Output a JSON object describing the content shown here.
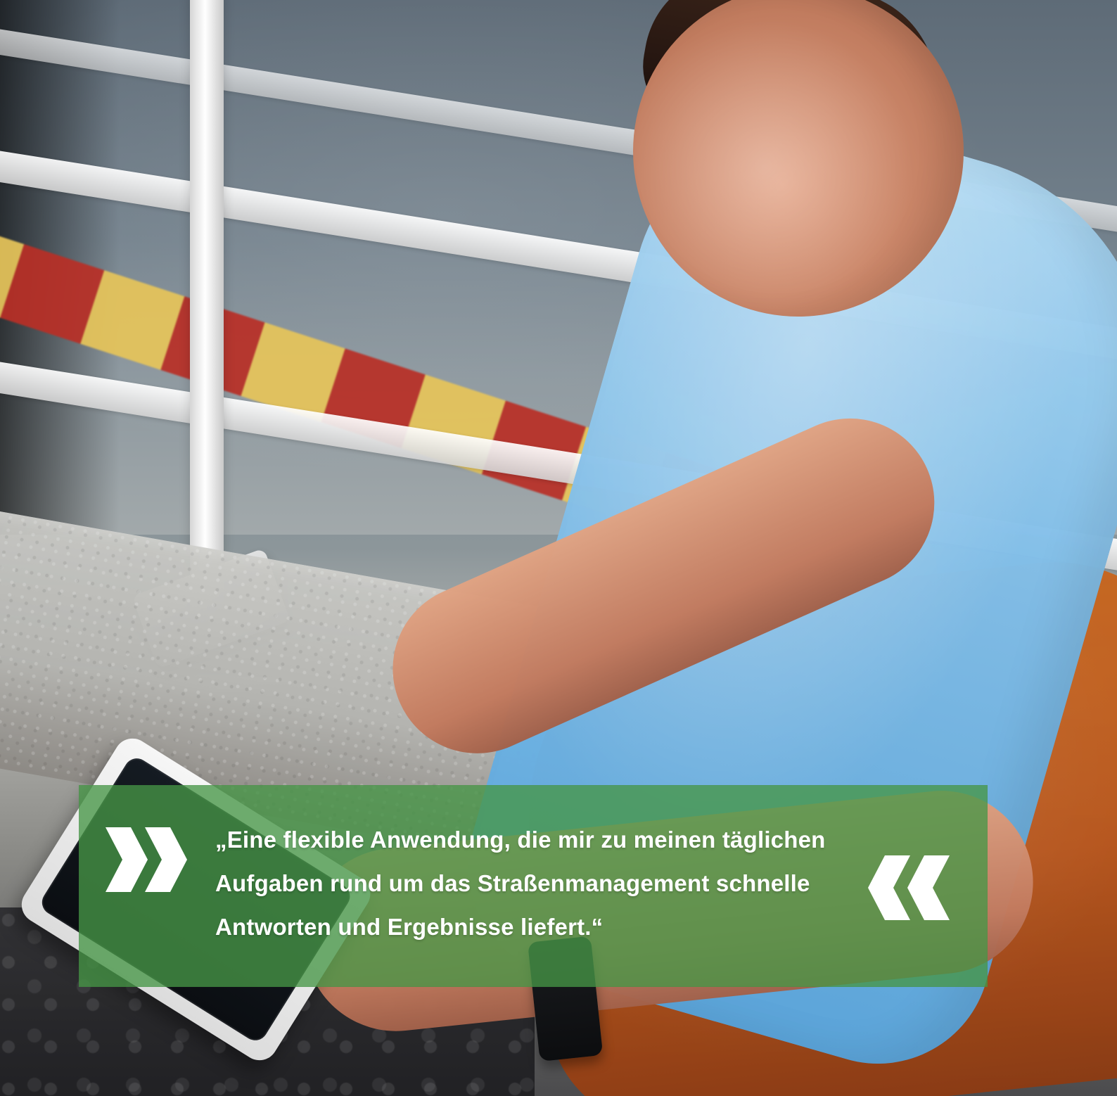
{
  "quote": {
    "line1": "„Eine flexible Anwendung, die mir zu meinen täglichen",
    "line2": "Aufgaben rund um das Straßenmanagement schnelle",
    "line3": "Antworten und Ergebnisse liefert.“"
  },
  "colors": {
    "overlay_green": "#469646",
    "text_white": "#FFFFFF"
  },
  "icons": {
    "left_marks": "double-chevron-right-icon",
    "right_marks": "double-chevron-left-icon"
  }
}
